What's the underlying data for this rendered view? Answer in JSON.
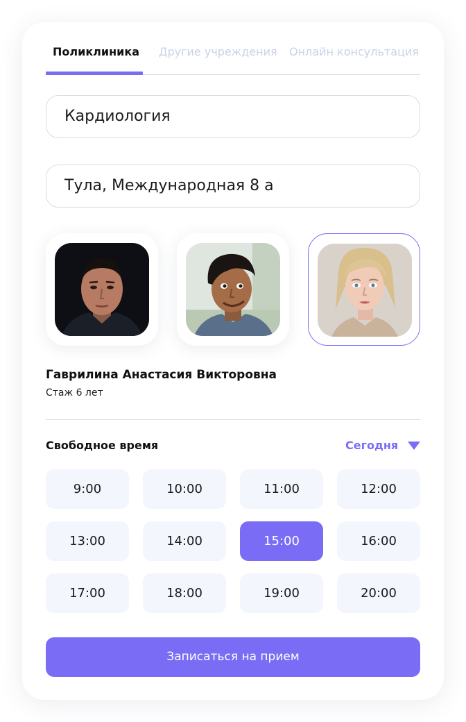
{
  "tabs": [
    {
      "label": "Поликлиника",
      "active": true
    },
    {
      "label": "Другие учреждения",
      "active": false
    },
    {
      "label": "Онлайн консультация",
      "active": false
    }
  ],
  "specialty_field": {
    "value": "Кардиология"
  },
  "address_field": {
    "value": "Тула, Международная 8 а"
  },
  "doctors": [
    {
      "photo": "doctor-photo-man-dark",
      "selected": false
    },
    {
      "photo": "doctor-photo-man-smiling",
      "selected": false
    },
    {
      "photo": "doctor-photo-woman-blonde",
      "selected": true
    }
  ],
  "selected_doctor": {
    "name": "Гаврилина Анастасия Викторовна",
    "experience": "Стаж 6 лет"
  },
  "schedule": {
    "title": "Свободное время",
    "day": "Сегодня",
    "slots": [
      "9:00",
      "10:00",
      "11:00",
      "12:00",
      "13:00",
      "14:00",
      "15:00",
      "16:00",
      "17:00",
      "18:00",
      "19:00",
      "20:00"
    ],
    "selected_slot": "15:00"
  },
  "submit_button": {
    "label": "Записаться на прием"
  },
  "colors": {
    "accent": "#7b6cf5",
    "slot_background": "#f3f6fd",
    "border": "#d9dce8",
    "inactive_tab": "#cbd2ea"
  }
}
